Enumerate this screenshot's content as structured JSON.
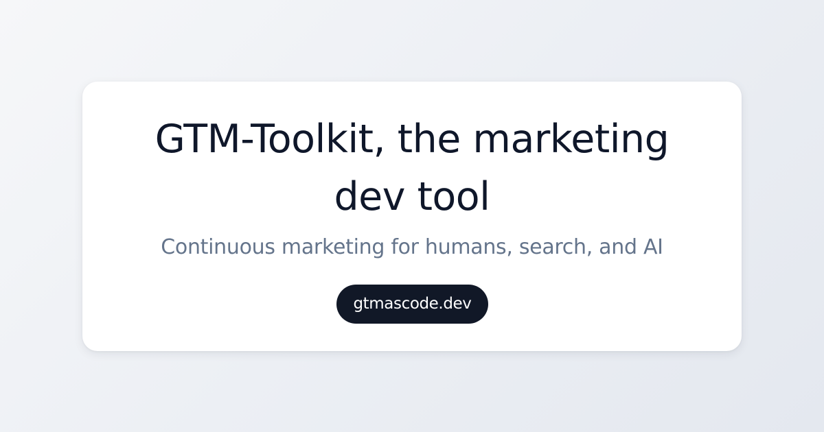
{
  "card": {
    "title": "GTM-Toolkit, the marketing dev tool",
    "subtitle": "Continuous marketing for humans, search, and AI",
    "url": "gtmascode.dev"
  },
  "colors": {
    "title": "#0f172a",
    "subtitle": "#64748b",
    "pill_background": "#111827",
    "pill_text": "#ffffff",
    "card_background": "#ffffff"
  }
}
